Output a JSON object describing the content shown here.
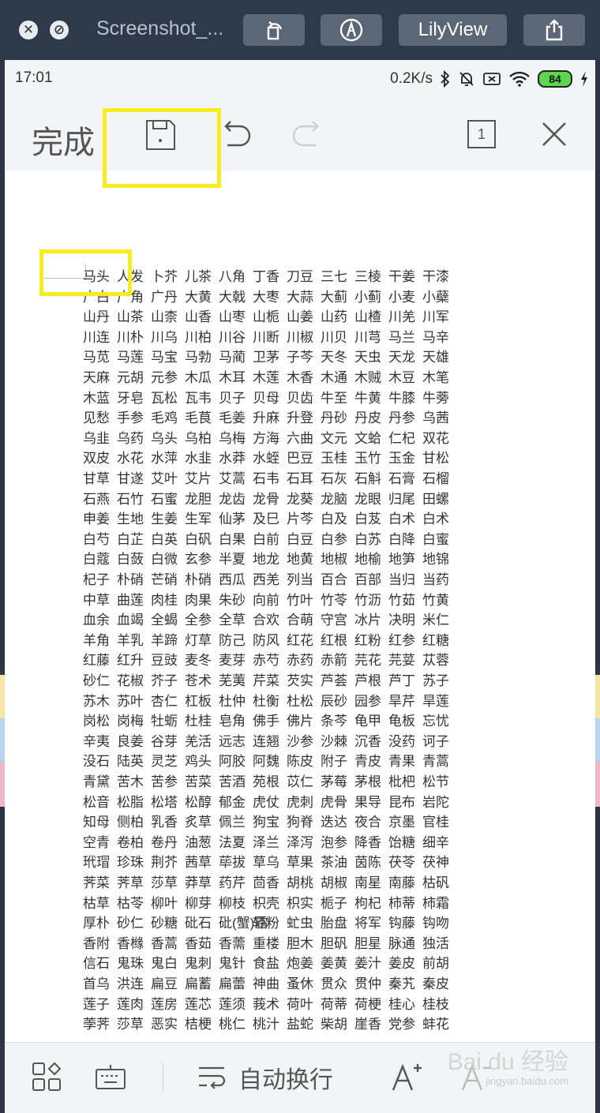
{
  "window": {
    "title": "Screenshot_...",
    "viewer_label": "LilyView"
  },
  "status": {
    "time": "17:01",
    "speed": "0.2K/s",
    "battery": "84"
  },
  "editor": {
    "done_label": "完成",
    "page_count": "1",
    "wrap_label": "自动换行"
  },
  "watermark": {
    "text": "Bai du 经验",
    "sub": "jingyan.baidu.com"
  },
  "words": [
    "马头",
    "人发",
    "卜芥",
    "儿茶",
    "八角",
    "丁香",
    "刀豆",
    "三七",
    "三棱",
    "干姜",
    "干漆",
    "广白",
    "广角",
    "广丹",
    "大黄",
    "大戟",
    "大枣",
    "大蒜",
    "大蓟",
    "小蓟",
    "小麦",
    "小蘗",
    "山丹",
    "山茶",
    "山柰",
    "山香",
    "山枣",
    "山栀",
    "山姜",
    "山药",
    "山楂",
    "川羌",
    "川军",
    "川连",
    "川朴",
    "川乌",
    "川柏",
    "川谷",
    "川断",
    "川椒",
    "川贝",
    "川芎",
    "马兰",
    "马辛",
    "马苋",
    "马莲",
    "马宝",
    "马勃",
    "马蔺",
    "卫茅",
    "子芩",
    "天冬",
    "天虫",
    "天龙",
    "天雄",
    "天麻",
    "元胡",
    "元参",
    "木瓜",
    "木耳",
    "木莲",
    "木香",
    "木通",
    "木贼",
    "木豆",
    "木笔",
    "木蓝",
    "牙皂",
    "瓦松",
    "瓦韦",
    "贝子",
    "贝母",
    "贝齿",
    "牛至",
    "牛黄",
    "牛膝",
    "牛蒡",
    "见愁",
    "手参",
    "毛鸡",
    "毛茛",
    "毛姜",
    "升麻",
    "升登",
    "丹砂",
    "丹皮",
    "丹参",
    "乌茜",
    "乌韭",
    "乌药",
    "乌头",
    "乌柏",
    "乌梅",
    "方海",
    "六曲",
    "文元",
    "文蛤",
    "仁杞",
    "双花",
    "双皮",
    "水花",
    "水萍",
    "水韭",
    "水莽",
    "水蛭",
    "巴豆",
    "玉桂",
    "玉竹",
    "玉金",
    "甘松",
    "甘草",
    "甘遂",
    "艾叶",
    "艾片",
    "艾蒿",
    "石韦",
    "石耳",
    "石灰",
    "石斛",
    "石膏",
    "石榴",
    "石燕",
    "石竹",
    "石蜜",
    "龙胆",
    "龙齿",
    "龙骨",
    "龙葵",
    "龙脑",
    "龙眼",
    "归尾",
    "田螺",
    "申姜",
    "生地",
    "生姜",
    "生军",
    "仙茅",
    "及巳",
    "片芩",
    "白及",
    "白芨",
    "白术",
    "白术",
    "白芍",
    "白芷",
    "白英",
    "白矾",
    "白果",
    "白前",
    "白豆",
    "白参",
    "白苏",
    "白降",
    "白蜜",
    "白蔻",
    "白蔹",
    "白微",
    "玄参",
    "半夏",
    "地龙",
    "地黄",
    "地椒",
    "地榆",
    "地笋",
    "地锦",
    "杞子",
    "朴硝",
    "芒硝",
    "朴硝",
    "西瓜",
    "西羌",
    "列当",
    "百合",
    "百部",
    "当归",
    "当药",
    "中草",
    "曲莲",
    "肉桂",
    "肉果",
    "朱砂",
    "向前",
    "竹叶",
    "竹苓",
    "竹沥",
    "竹茹",
    "竹黄",
    "血余",
    "血竭",
    "全蝎",
    "全参",
    "全草",
    "合欢",
    "合萌",
    "守宫",
    "冰片",
    "决明",
    "米仁",
    "羊角",
    "羊乳",
    "羊蹄",
    "灯草",
    "防己",
    "防风",
    "红花",
    "红根",
    "红粉",
    "红参",
    "红糖",
    "红藤",
    "红升",
    "豆豉",
    "麦冬",
    "麦芽",
    "赤芍",
    "赤药",
    "赤箭",
    "芫花",
    "芫荽",
    "苁蓉",
    "砂仁",
    "花椒",
    "芥子",
    "苍术",
    "芜荑",
    "芹菜",
    "芡实",
    "芦荟",
    "芦根",
    "芦丁",
    "苏子",
    "苏木",
    "苏叶",
    "杏仁",
    "杠板",
    "杜仲",
    "杜衡",
    "杜松",
    "辰砂",
    "园参",
    "旱芹",
    "旱莲",
    "岗松",
    "岗梅",
    "牡蛎",
    "杜桂",
    "皂角",
    "佛手",
    "佛片",
    "条芩",
    "龟甲",
    "龟板",
    "忘忧",
    "辛夷",
    "良姜",
    "谷芽",
    "羌活",
    "远志",
    "连翘",
    "沙参",
    "沙棘",
    "沉香",
    "没药",
    "诃子",
    "没石",
    "陆英",
    "灵芝",
    "鸡头",
    "阿胶",
    "阿魏",
    "陈皮",
    "附子",
    "青皮",
    "青果",
    "青蒿",
    "青黛",
    "苦木",
    "苦参",
    "苦菜",
    "苦酒",
    "苑根",
    "苡仁",
    "茅莓",
    "茅根",
    "枇杷",
    "松节",
    "松音",
    "松脂",
    "松塔",
    "松醇",
    "郁金",
    "虎仗",
    "虎刺",
    "虎骨",
    "果导",
    "昆布",
    "岩陀",
    "知母",
    "侧柏",
    "乳香",
    "炙草",
    "佩兰",
    "狗宝",
    "狗脊",
    "迭达",
    "夜合",
    "京墨",
    "官桂",
    "空青",
    "卷柏",
    "卷丹",
    "油葱",
    "法夏",
    "泽兰",
    "泽泻",
    "泡参",
    "降香",
    "饴糖",
    "细辛",
    "玳瑁",
    "珍珠",
    "荆芥",
    "茜草",
    "荜拔",
    "草乌",
    "草果",
    "茶油",
    "茵陈",
    "茯苓",
    "茯神",
    "荠菜",
    "荠草",
    "莎草",
    "莽草",
    "药芹",
    "茴香",
    "胡桃",
    "胡椒",
    "南星",
    "南藤",
    "枯矾",
    "枯草",
    "枯苓",
    "柳叶",
    "柳芽",
    "柳枝",
    "枳壳",
    "枳实",
    "栀子",
    "枸杞",
    "柿蒂",
    "柿霜",
    "厚朴",
    "砂仁",
    "砂糖",
    "砒石",
    "砒(蟹)霜",
    "轻粉",
    "虻虫",
    "胎盘",
    "将军",
    "钩藤",
    "钩吻",
    "香附",
    "香橼",
    "香蒿",
    "香茹",
    "香薷",
    "重楼",
    "胆木",
    "胆矾",
    "胆星",
    "脉通",
    "独活",
    "信石",
    "鬼珠",
    "鬼白",
    "鬼刺",
    "鬼针",
    "食盐",
    "炮姜",
    "姜黄",
    "姜汁",
    "姜皮",
    "前胡",
    "首乌",
    "洪连",
    "扁豆",
    "扁蓄",
    "扁蕾",
    "神曲",
    "蚤休",
    "贯众",
    "贯仲",
    "秦艽",
    "秦皮",
    "莲子",
    "莲肉",
    "莲房",
    "莲芯",
    "莲须",
    "莪术",
    "荷叶",
    "荷蒂",
    "荷梗",
    "桂心",
    "桂枝",
    "荸荠",
    "莎草",
    "恶实",
    "桔梗",
    "桃仁",
    "桃汁",
    "盐蛇",
    "柴胡",
    "崖香",
    "党参",
    "蚌花"
  ]
}
